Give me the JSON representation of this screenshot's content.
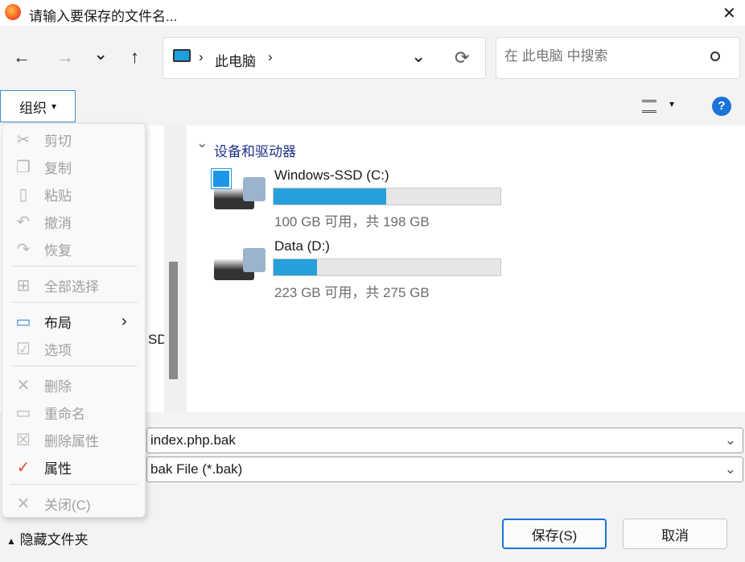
{
  "window": {
    "title": "请输入要保存的文件名...",
    "close": "✕"
  },
  "nav": {
    "back": "←",
    "forward": "→",
    "recent": "⌄",
    "up": "↑",
    "breadcrumb": [
      "此电脑"
    ],
    "sep": "›",
    "refresh": "⟳",
    "dropdown": "⌄"
  },
  "search": {
    "placeholder": "在 此电脑 中搜索"
  },
  "toolbar": {
    "organize": "组织",
    "organize_arrow": "▾",
    "view_arrow": "▾",
    "help": "?"
  },
  "menu": {
    "items": [
      {
        "label": "剪切",
        "icon": "scissors-icon",
        "glyph": "✂",
        "enabled": false
      },
      {
        "label": "复制",
        "icon": "copy-icon",
        "glyph": "❐",
        "enabled": false
      },
      {
        "label": "粘贴",
        "icon": "clipboard-icon",
        "glyph": "▯",
        "enabled": false
      },
      {
        "label": "撤消",
        "icon": "undo-icon",
        "glyph": "↶",
        "enabled": false
      },
      {
        "label": "恢复",
        "icon": "redo-icon",
        "glyph": "↷",
        "enabled": false
      },
      {
        "label": "全部选择",
        "icon": "select-all-icon",
        "glyph": "⊞",
        "enabled": false
      },
      {
        "label": "布局",
        "icon": "layout-icon",
        "glyph": "▭",
        "enabled": true,
        "submenu": "›"
      },
      {
        "label": "选项",
        "icon": "options-icon",
        "glyph": "☑",
        "enabled": false
      },
      {
        "label": "删除",
        "icon": "delete-icon",
        "glyph": "✕",
        "enabled": false
      },
      {
        "label": "重命名",
        "icon": "rename-icon",
        "glyph": "▭",
        "enabled": false
      },
      {
        "label": "删除属性",
        "icon": "remove-properties-icon",
        "glyph": "☒",
        "enabled": false
      },
      {
        "label": "属性",
        "icon": "properties-icon",
        "glyph": "✓",
        "enabled": true
      },
      {
        "label": "关闭(C)",
        "icon": "close-icon",
        "glyph": "✕",
        "enabled": false
      }
    ]
  },
  "left_pane": {
    "partial_text": "SD"
  },
  "section": {
    "title": "设备和驱动器",
    "chevron": "⌄"
  },
  "drives": [
    {
      "name": "Windows-SSD (C:)",
      "info": "100 GB 可用，共 198 GB",
      "used_percent": 49.5
    },
    {
      "name": "Data (D:)",
      "info": "223 GB 可用，共 275 GB",
      "used_percent": 19
    }
  ],
  "filename": {
    "value": "index.php.bak"
  },
  "filetype": {
    "value": "bak File (*.bak)"
  },
  "footer": {
    "hide_folders": "隐藏文件夹",
    "save": "保存(S)",
    "cancel": "取消"
  },
  "colors": {
    "accent": "#26a0da",
    "help": "#1a73d8"
  }
}
